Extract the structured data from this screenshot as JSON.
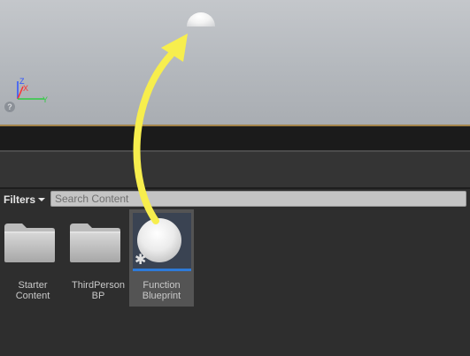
{
  "viewport": {
    "axis_labels": {
      "z": "Z",
      "x": "X",
      "y": "Y"
    },
    "help_glyph": "?",
    "icons": [
      "axis-gizmo-icon",
      "help-icon"
    ]
  },
  "content_browser": {
    "filters_label": "Filters",
    "search_placeholder": "Search Content",
    "assets": [
      {
        "label": "Starter\nContent",
        "icon": "folder-icon"
      },
      {
        "label": "ThirdPerson\nBP",
        "icon": "folder-icon"
      },
      {
        "label": "Function\nBlueprint",
        "icon": "sphere-thumbnail",
        "selected": true,
        "badge": "✱"
      }
    ]
  },
  "colors": {
    "drag_arrow": "#f7ee4d",
    "selection_bar": "#2e7ad8",
    "viewport_border": "#a3834a"
  }
}
